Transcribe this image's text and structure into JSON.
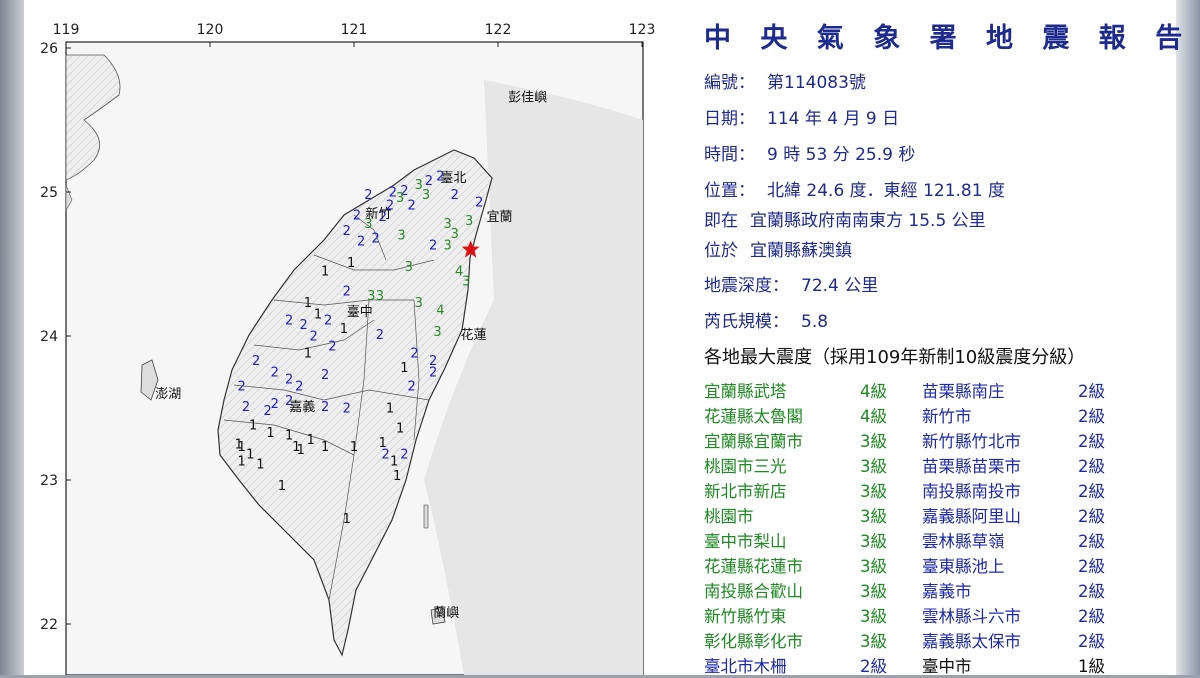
{
  "report": {
    "title": "中 央 氣 象 署 地 震 報 告",
    "number_label": "編號：",
    "number_value": "第114083號",
    "date_label": "日期：",
    "date_value": "114 年 4 月 9 日",
    "time_label": "時間：",
    "time_value": "9 時 53 分 25.9 秒",
    "location_label": "位置：",
    "location_value": "北緯 24.6 度．東經 121.81 度",
    "relative_prefix": "即在",
    "relative_value": "宜蘭縣政府南南東方 15.5 公里",
    "located_prefix": "位於",
    "located_value": "宜蘭縣蘇澳鎮",
    "depth_label": "地震深度：",
    "depth_value": "72.4 公里",
    "magnitude_label": "芮氏規模：",
    "magnitude_value": "5.8",
    "intensity_heading": "各地最大震度（採用109年新制10級震度分級）"
  },
  "intensity_rows": [
    {
      "a_station": "宜蘭縣武塔",
      "a_level": "4級",
      "a_color": "green",
      "b_station": "苗栗縣南庄",
      "b_level": "2級",
      "b_color": "blue"
    },
    {
      "a_station": "花蓮縣太魯閣",
      "a_level": "4級",
      "a_color": "green",
      "b_station": "新竹市",
      "b_level": "2級",
      "b_color": "blue"
    },
    {
      "a_station": "宜蘭縣宜蘭市",
      "a_level": "3級",
      "a_color": "green",
      "b_station": "新竹縣竹北市",
      "b_level": "2級",
      "b_color": "blue"
    },
    {
      "a_station": "桃園市三光",
      "a_level": "3級",
      "a_color": "green",
      "b_station": "苗栗縣苗栗市",
      "b_level": "2級",
      "b_color": "blue"
    },
    {
      "a_station": "新北市新店",
      "a_level": "3級",
      "a_color": "green",
      "b_station": "南投縣南投市",
      "b_level": "2級",
      "b_color": "blue"
    },
    {
      "a_station": "桃園市",
      "a_level": "3級",
      "a_color": "green",
      "b_station": "嘉義縣阿里山",
      "b_level": "2級",
      "b_color": "blue"
    },
    {
      "a_station": "臺中市梨山",
      "a_level": "3級",
      "a_color": "green",
      "b_station": "雲林縣草嶺",
      "b_level": "2級",
      "b_color": "blue"
    },
    {
      "a_station": "花蓮縣花蓮市",
      "a_level": "3級",
      "a_color": "green",
      "b_station": "臺東縣池上",
      "b_level": "2級",
      "b_color": "blue"
    },
    {
      "a_station": "南投縣合歡山",
      "a_level": "3級",
      "a_color": "green",
      "b_station": "嘉義市",
      "b_level": "2級",
      "b_color": "blue"
    },
    {
      "a_station": "新竹縣竹東",
      "a_level": "3級",
      "a_color": "green",
      "b_station": "雲林縣斗六市",
      "b_level": "2級",
      "b_color": "blue"
    },
    {
      "a_station": "彰化縣彰化市",
      "a_level": "3級",
      "a_color": "green",
      "b_station": "嘉義縣太保市",
      "b_level": "2級",
      "b_color": "blue"
    },
    {
      "a_station": "臺北市木柵",
      "a_level": "2級",
      "a_color": "blue",
      "b_station": "臺中市",
      "b_level": "1級",
      "b_color": "dark"
    }
  ],
  "map": {
    "lon_ticks": [
      "119",
      "120",
      "121",
      "122",
      "123"
    ],
    "lat_ticks": [
      "26",
      "25",
      "24",
      "23",
      "22"
    ],
    "place_labels": [
      "彭佳嶼",
      "臺北",
      "宜蘭",
      "新竹",
      "臺中",
      "花蓮",
      "澎湖",
      "嘉義",
      "蘭嶼"
    ],
    "epicenter_symbol": "star",
    "colors": {
      "intensity_4": "#2a8a2a",
      "intensity_3": "#2a8a2a",
      "intensity_2": "#2020c8",
      "intensity_1": "#111111",
      "epicenter": "#e01010",
      "title": "#1d2a8e"
    },
    "markers": [
      {
        "v": "2",
        "lon": 121.52,
        "lat": 25.05
      },
      {
        "v": "2",
        "lon": 121.6,
        "lat": 25.08
      },
      {
        "v": "3",
        "lon": 121.45,
        "lat": 25.02
      },
      {
        "v": "2",
        "lon": 121.35,
        "lat": 24.98
      },
      {
        "v": "3",
        "lon": 121.32,
        "lat": 24.93
      },
      {
        "v": "2",
        "lon": 121.27,
        "lat": 24.97
      },
      {
        "v": "2",
        "lon": 121.1,
        "lat": 24.95
      },
      {
        "v": "2",
        "lon": 121.25,
        "lat": 24.88
      },
      {
        "v": "2",
        "lon": 121.02,
        "lat": 24.81
      },
      {
        "v": "3",
        "lon": 121.1,
        "lat": 24.75
      },
      {
        "v": "2",
        "lon": 121.2,
        "lat": 24.8
      },
      {
        "v": "3",
        "lon": 121.5,
        "lat": 24.95
      },
      {
        "v": "2",
        "lon": 121.4,
        "lat": 24.88
      },
      {
        "v": "3",
        "lon": 121.65,
        "lat": 24.75
      },
      {
        "v": "3",
        "lon": 121.7,
        "lat": 24.68
      },
      {
        "v": "2",
        "lon": 121.55,
        "lat": 24.6
      },
      {
        "v": "3",
        "lon": 121.65,
        "lat": 24.6
      },
      {
        "v": "2",
        "lon": 121.7,
        "lat": 24.95
      },
      {
        "v": "2",
        "lon": 121.87,
        "lat": 24.9
      },
      {
        "v": "3",
        "lon": 121.8,
        "lat": 24.77
      },
      {
        "v": "2",
        "lon": 120.95,
        "lat": 24.7
      },
      {
        "v": "2",
        "lon": 121.05,
        "lat": 24.63
      },
      {
        "v": "2",
        "lon": 121.15,
        "lat": 24.65
      },
      {
        "v": "3",
        "lon": 121.33,
        "lat": 24.67
      },
      {
        "v": "1",
        "lon": 120.8,
        "lat": 24.42
      },
      {
        "v": "1",
        "lon": 120.98,
        "lat": 24.48
      },
      {
        "v": "3",
        "lon": 121.38,
        "lat": 24.45
      },
      {
        "v": "2",
        "lon": 120.95,
        "lat": 24.28
      },
      {
        "v": "3",
        "lon": 121.12,
        "lat": 24.25
      },
      {
        "v": "3",
        "lon": 121.18,
        "lat": 24.25
      },
      {
        "v": "3",
        "lon": 121.45,
        "lat": 24.2
      },
      {
        "v": "4",
        "lon": 121.73,
        "lat": 24.42
      },
      {
        "v": "3",
        "lon": 121.78,
        "lat": 24.35
      },
      {
        "v": "1",
        "lon": 120.68,
        "lat": 24.2
      },
      {
        "v": "1",
        "lon": 120.75,
        "lat": 24.12
      },
      {
        "v": "2",
        "lon": 120.82,
        "lat": 24.08
      },
      {
        "v": "2",
        "lon": 120.55,
        "lat": 24.08
      },
      {
        "v": "2",
        "lon": 120.65,
        "lat": 24.05
      },
      {
        "v": "1",
        "lon": 120.93,
        "lat": 24.02
      },
      {
        "v": "2",
        "lon": 120.72,
        "lat": 23.97
      },
      {
        "v": "2",
        "lon": 120.85,
        "lat": 23.9
      },
      {
        "v": "2",
        "lon": 121.18,
        "lat": 23.98
      },
      {
        "v": "4",
        "lon": 121.6,
        "lat": 24.15
      },
      {
        "v": "3",
        "lon": 121.58,
        "lat": 24.0
      },
      {
        "v": "1",
        "lon": 120.68,
        "lat": 23.85
      },
      {
        "v": "2",
        "lon": 121.42,
        "lat": 23.85
      },
      {
        "v": "2",
        "lon": 121.55,
        "lat": 23.8
      },
      {
        "v": "1",
        "lon": 121.35,
        "lat": 23.75
      },
      {
        "v": "2",
        "lon": 120.32,
        "lat": 23.8
      },
      {
        "v": "2",
        "lon": 120.45,
        "lat": 23.72
      },
      {
        "v": "2",
        "lon": 120.55,
        "lat": 23.67
      },
      {
        "v": "2",
        "lon": 120.62,
        "lat": 23.62
      },
      {
        "v": "2",
        "lon": 120.8,
        "lat": 23.7
      },
      {
        "v": "2",
        "lon": 120.22,
        "lat": 23.62
      },
      {
        "v": "2",
        "lon": 121.4,
        "lat": 23.62
      },
      {
        "v": "2",
        "lon": 121.55,
        "lat": 23.72
      },
      {
        "v": "2",
        "lon": 120.45,
        "lat": 23.5
      },
      {
        "v": "2",
        "lon": 120.55,
        "lat": 23.52
      },
      {
        "v": "2",
        "lon": 120.8,
        "lat": 23.48
      },
      {
        "v": "2",
        "lon": 120.95,
        "lat": 23.47
      },
      {
        "v": "2",
        "lon": 120.4,
        "lat": 23.45
      },
      {
        "v": "2",
        "lon": 120.25,
        "lat": 23.48
      },
      {
        "v": "1",
        "lon": 120.3,
        "lat": 23.35
      },
      {
        "v": "1",
        "lon": 121.25,
        "lat": 23.47
      },
      {
        "v": "1",
        "lon": 120.42,
        "lat": 23.3
      },
      {
        "v": "1",
        "lon": 121.32,
        "lat": 23.33
      },
      {
        "v": "1",
        "lon": 120.2,
        "lat": 23.22
      },
      {
        "v": "1",
        "lon": 120.55,
        "lat": 23.28
      },
      {
        "v": "1",
        "lon": 120.7,
        "lat": 23.25
      },
      {
        "v": "1",
        "lon": 120.6,
        "lat": 23.2
      },
      {
        "v": "1",
        "lon": 120.63,
        "lat": 23.18
      },
      {
        "v": "1",
        "lon": 120.22,
        "lat": 23.2
      },
      {
        "v": "1",
        "lon": 120.28,
        "lat": 23.15
      },
      {
        "v": "1",
        "lon": 120.8,
        "lat": 23.2
      },
      {
        "v": "1",
        "lon": 121.0,
        "lat": 23.2
      },
      {
        "v": "1",
        "lon": 121.2,
        "lat": 23.23
      },
      {
        "v": "1",
        "lon": 121.28,
        "lat": 23.1
      },
      {
        "v": "2",
        "lon": 121.22,
        "lat": 23.15
      },
      {
        "v": "2",
        "lon": 121.35,
        "lat": 23.15
      },
      {
        "v": "1",
        "lon": 120.22,
        "lat": 23.1
      },
      {
        "v": "1",
        "lon": 120.35,
        "lat": 23.08
      },
      {
        "v": "1",
        "lon": 121.3,
        "lat": 23.0
      },
      {
        "v": "1",
        "lon": 120.5,
        "lat": 22.93
      },
      {
        "v": "1",
        "lon": 120.95,
        "lat": 22.7
      }
    ]
  }
}
